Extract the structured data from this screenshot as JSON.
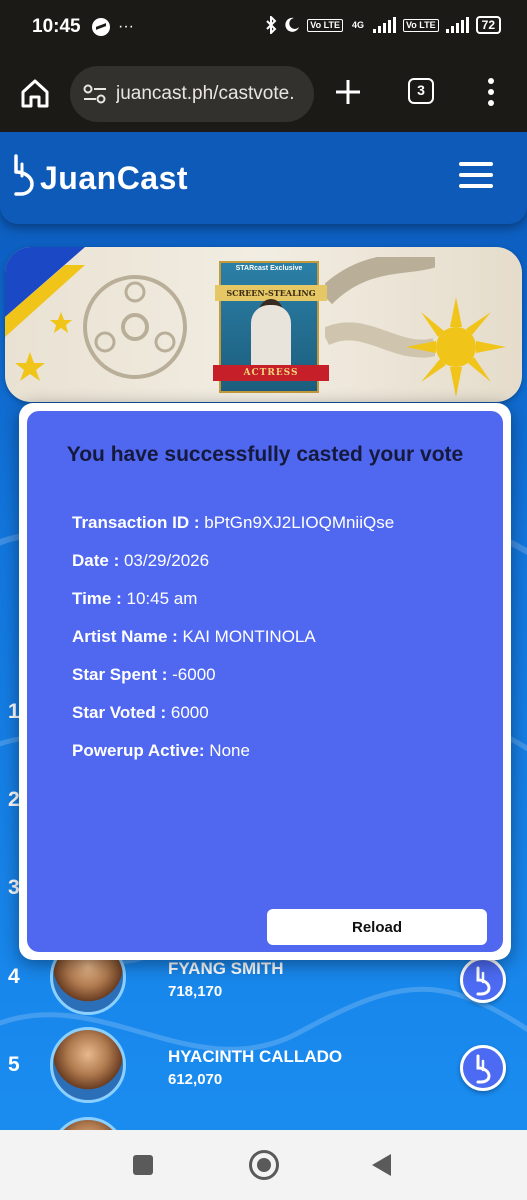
{
  "status_bar": {
    "time": "10:45",
    "extra": "···",
    "battery": "72",
    "tag_1": "Vo LTE",
    "tag_2": "4G",
    "tag_3": "Vo LTE"
  },
  "browser": {
    "url": "juancast.ph/castvote.",
    "tab_count": "3"
  },
  "header": {
    "brand": "JuanCast"
  },
  "banner": {
    "poster_tag": "STARcast Exclusive",
    "poster_title": "SCREEN-STEALING",
    "poster_subtitle": "ACTRESS"
  },
  "modal": {
    "title": "You have successfully casted your vote",
    "details": [
      {
        "label": "Transaction ID : ",
        "value": "bPtGn9XJ2LIOQMniiQse"
      },
      {
        "label": "Date : ",
        "value": "03/29/2026"
      },
      {
        "label": "Time : ",
        "value": "10:45 am"
      },
      {
        "label": "Artist Name : ",
        "value": "KAI MONTINOLA"
      },
      {
        "label": "Star Spent : ",
        "value": "-6000"
      },
      {
        "label": "Star Voted : ",
        "value": "6000"
      },
      {
        "label": "Powerup Active: ",
        "value": "None"
      }
    ],
    "reload_label": "Reload"
  },
  "rankings": [
    {
      "rank": "1",
      "name": "",
      "votes": ""
    },
    {
      "rank": "2",
      "name": "",
      "votes": ""
    },
    {
      "rank": "3",
      "name": "",
      "votes": ""
    },
    {
      "rank": "4",
      "name": "FYANG SMITH",
      "votes": "718,170"
    },
    {
      "rank": "5",
      "name": "HYACINTH CALLADO",
      "votes": "612,070"
    }
  ],
  "colors": {
    "page_blue": "#1276dd",
    "modal_blue": "#5068f0",
    "modal_title": "#15193d",
    "vote_button": "#4c6bf2"
  }
}
